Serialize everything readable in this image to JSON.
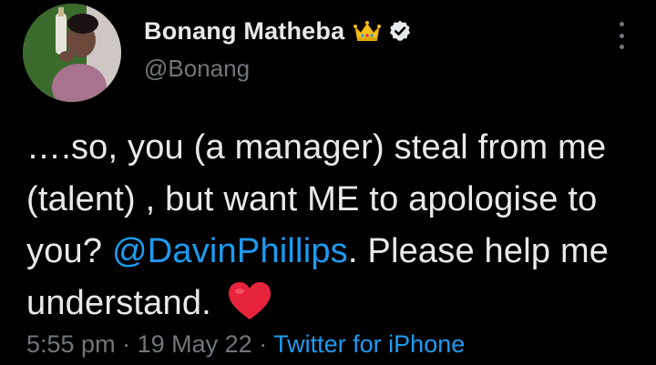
{
  "author": {
    "display_name": "Bonang Matheba",
    "handle": "@Bonang",
    "verified": true,
    "crown_badge": "crown-icon"
  },
  "tweet": {
    "text_before_mention": "….so, you (a manager) steal from me (talent) , but want ME to apologise to you? ",
    "mention": "@DavinPhillips",
    "text_after_mention": ". Please help me understand. ",
    "emoji": "heart-icon"
  },
  "meta": {
    "time": "5:55 pm",
    "separator_1": " · ",
    "date": "19 May 22",
    "separator_2": " · ",
    "source": "Twitter for iPhone"
  },
  "colors": {
    "background": "#000000",
    "text": "#e7e9ea",
    "secondary": "#71767b",
    "link": "#1d9bf0",
    "heart": "#f91880"
  }
}
